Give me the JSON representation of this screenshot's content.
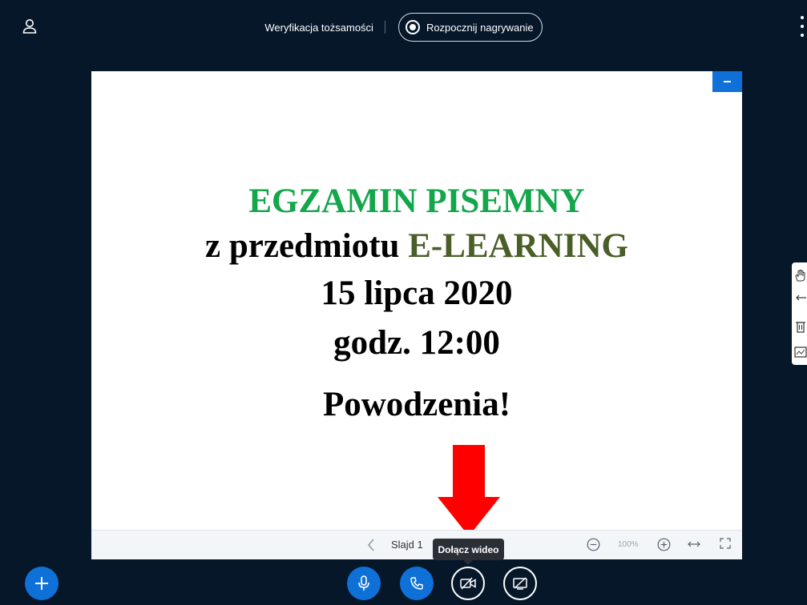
{
  "header": {
    "verification_label": "Weryfikacja tożsamości",
    "record_label": "Rozpocznij nagrywanie"
  },
  "slide": {
    "line1": "EGZAMIN PISEMNY",
    "line2_prefix": "z przedmiotu",
    "line2_subject": "E-LEARNING",
    "line3": "15 lipca 2020",
    "line4": "godz. 12:00",
    "line5": "Powodzenia!"
  },
  "slide_toolbar": {
    "slide_label": "Slajd 1",
    "zoom": "100%"
  },
  "tooltip": {
    "text": "Dołącz wideo"
  },
  "icons": {
    "user": "user-icon",
    "menu": "kebab-menu-icon",
    "record": "record-icon",
    "minimize": "minimize-icon",
    "prev": "chevron-left-icon",
    "zoom_out": "zoom-out-icon",
    "zoom_in": "zoom-in-icon",
    "fit": "fit-width-icon",
    "fullscreen": "fullscreen-icon",
    "hand": "hand-tool-icon",
    "undo": "undo-icon",
    "delete": "trash-icon",
    "whiteboard": "whiteboard-icon",
    "plus": "plus-icon",
    "mic": "microphone-icon",
    "phone": "phone-icon",
    "video": "video-off-icon",
    "share": "screen-share-off-icon"
  },
  "colors": {
    "background": "#06172a",
    "accent": "#0f70d7",
    "title_green": "#14a64a",
    "subject_green": "#4a5e27",
    "arrow_red": "#ff0000"
  }
}
